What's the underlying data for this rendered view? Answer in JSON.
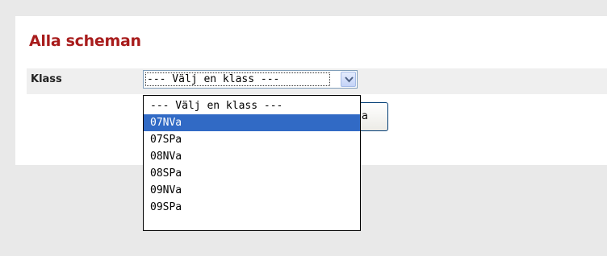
{
  "page": {
    "title": "Alla scheman"
  },
  "form": {
    "class_label": "Klass",
    "select": {
      "current_value": "--- Välj en klass ---",
      "arrow_icon": "chevron-down-icon"
    },
    "submit_label": "a"
  },
  "dropdown": {
    "options": [
      "--- Välj en klass ---",
      "07NVa",
      "07SPa",
      "08NVa",
      "08SPa",
      "09NVa",
      "09SPa"
    ],
    "highlighted_option": "07NVa"
  },
  "colors": {
    "title": "#a81c1c",
    "highlight": "#316ac5",
    "panel_background": "#ffffff",
    "page_background": "#e9e9e9"
  }
}
